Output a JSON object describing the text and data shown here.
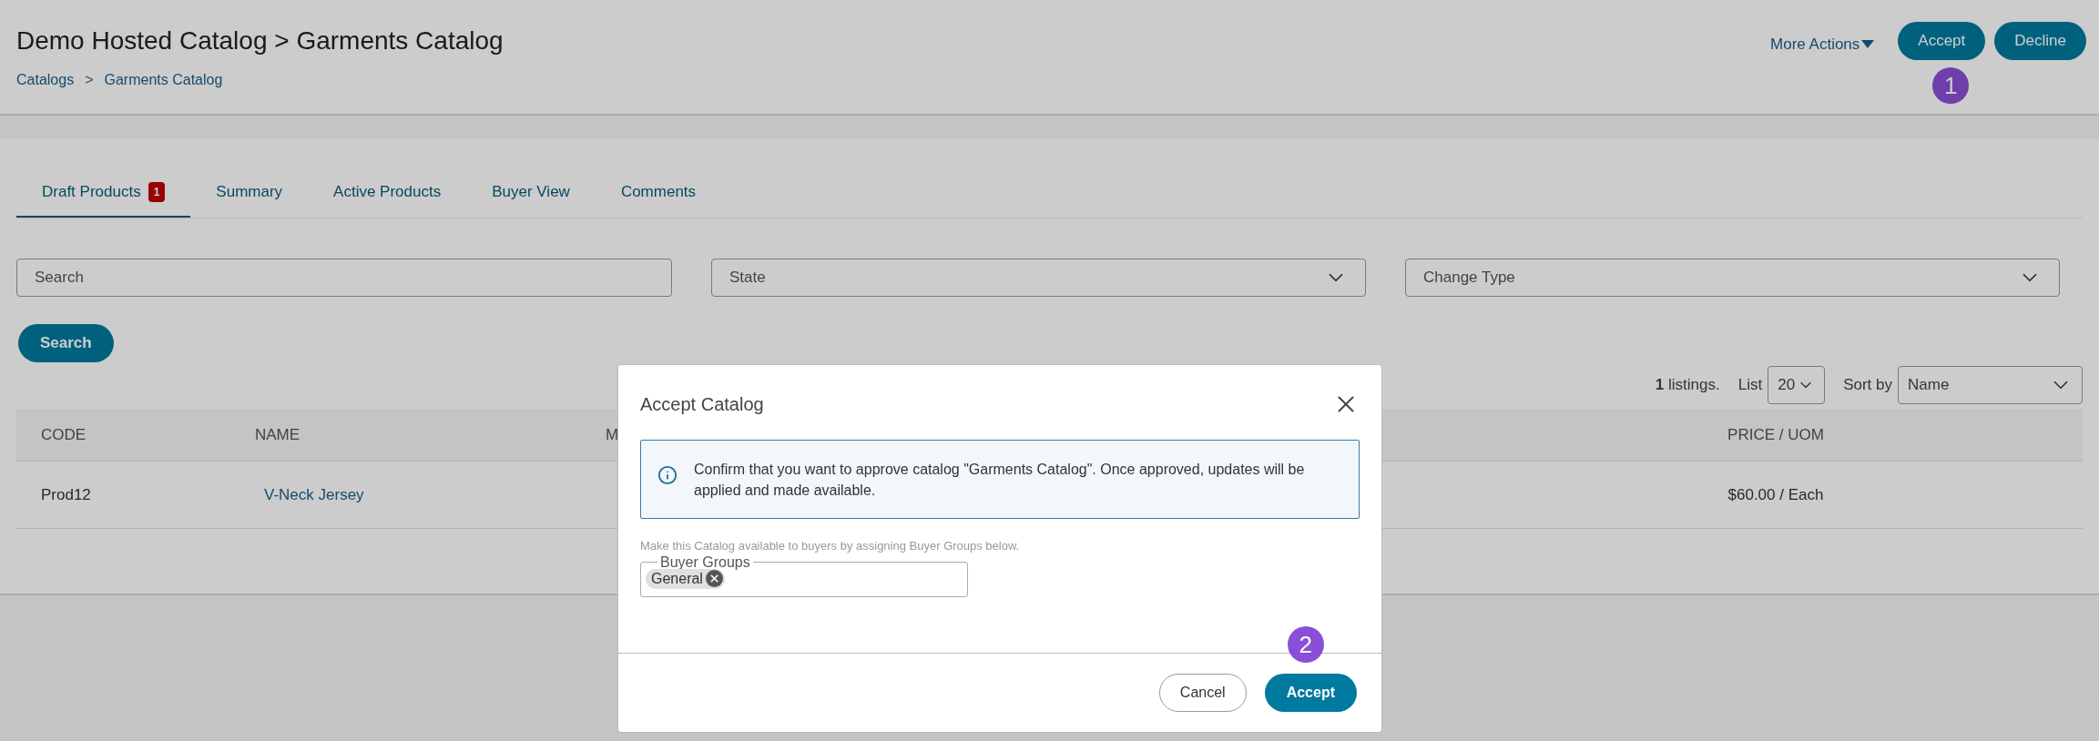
{
  "page_title": "Demo Hosted Catalog > Garments Catalog",
  "breadcrumbs": [
    {
      "label": "Catalogs"
    },
    {
      "label": "Garments Catalog"
    }
  ],
  "breadcrumb_separator": ">",
  "header_actions": {
    "more_actions": "More Actions",
    "accept": "Accept",
    "decline": "Decline"
  },
  "tabs": [
    {
      "label": "Draft Products",
      "selected": true,
      "badge": "1"
    },
    {
      "label": "Summary",
      "selected": false
    },
    {
      "label": "Active Products",
      "selected": false
    },
    {
      "label": "Buyer View",
      "selected": false
    },
    {
      "label": "Comments",
      "selected": false
    }
  ],
  "filters": {
    "search_placeholder": "Search",
    "state": "State",
    "change_type": "Change Type",
    "search_button": "Search"
  },
  "listing": {
    "count_text": "**1** listings.",
    "list_label": "List",
    "page_size": "20",
    "sort_label": "Sort by",
    "sort_value": "Name"
  },
  "table": {
    "columns": [
      "CODE",
      "NAME",
      "M",
      "PRICE / UOM"
    ],
    "rows": [
      {
        "code": "Prod12",
        "name": "V-Neck Jersey",
        "price_uom": "$60.00 / Each"
      }
    ]
  },
  "modal": {
    "title": "Accept Catalog",
    "message": "Confirm that you want to approve catalog \"Garments Catalog\". Once approved, updates will be applied and made available.",
    "help_text": "Make this Catalog available to buyers by assigning Buyer Groups below.",
    "buyer_groups_label": "Buyer Groups",
    "buyer_groups": [
      {
        "label": "General"
      }
    ],
    "cancel": "Cancel",
    "accept": "Accept"
  },
  "annotations": [
    {
      "number": "1"
    },
    {
      "number": "2"
    }
  ]
}
